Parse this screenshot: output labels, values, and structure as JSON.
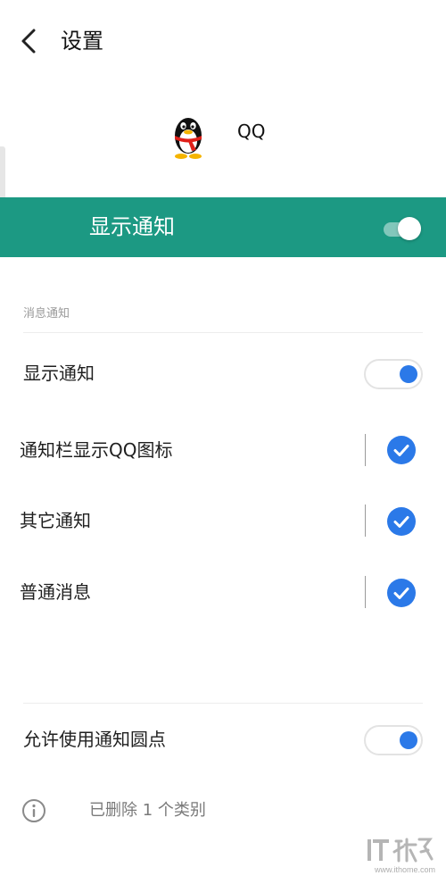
{
  "header": {
    "title": "设置",
    "back_icon": "chevron-left-icon"
  },
  "app": {
    "name": "QQ",
    "icon": "qq-penguin-icon"
  },
  "master": {
    "label": "显示通知",
    "enabled": true,
    "banner_color": "#1c9983"
  },
  "section": {
    "title": "消息通知"
  },
  "rows": [
    {
      "label": "显示通知",
      "control": "toggle",
      "on": true
    },
    {
      "label": "通知栏显示QQ图标",
      "control": "checkbox",
      "checked": true
    },
    {
      "label": "其它通知",
      "control": "checkbox",
      "checked": true
    },
    {
      "label": "普通消息",
      "control": "checkbox",
      "checked": true
    }
  ],
  "badge_row": {
    "label": "允许使用通知圆点",
    "control": "toggle",
    "on": true
  },
  "footer": {
    "info_text": "已删除 1 个类别",
    "icon": "info-icon"
  },
  "watermark": {
    "logo_text": "IT之家",
    "site": "www.ithome.com"
  },
  "colors": {
    "accent": "#2b79e8",
    "banner": "#1c9983"
  }
}
